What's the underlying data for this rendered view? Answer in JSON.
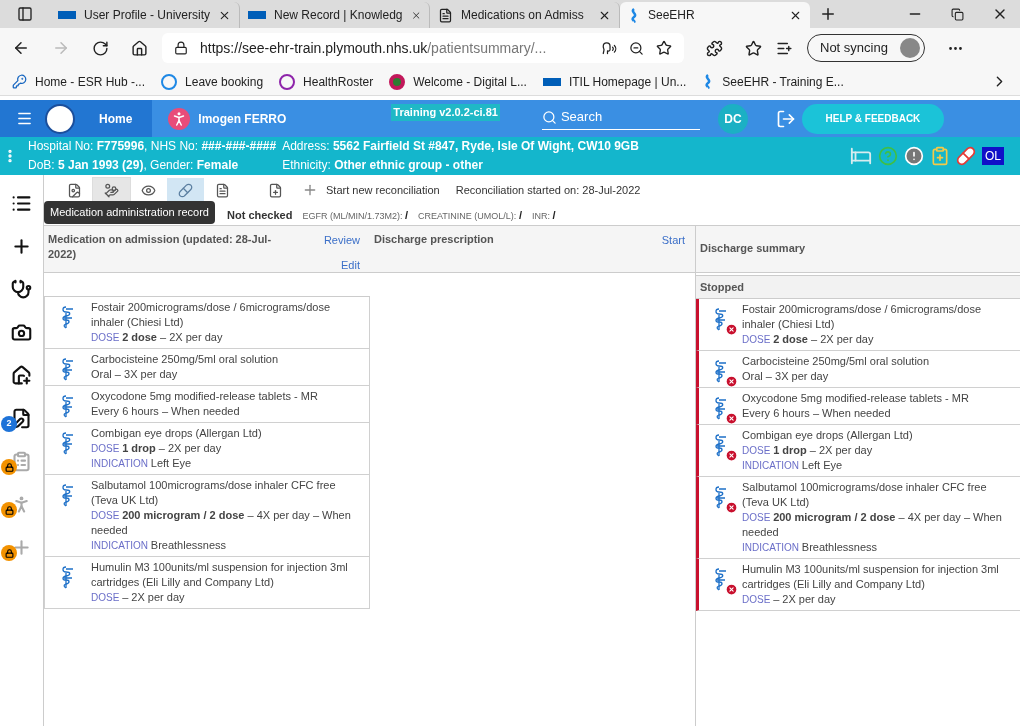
{
  "browser": {
    "tabs": [
      {
        "title": "User Profile - University",
        "selected": false
      },
      {
        "title": "New Record | Knowledg",
        "selected": false
      },
      {
        "title": "Medications on Admiss",
        "selected": false
      },
      {
        "title": "SeeEHR",
        "selected": true
      }
    ],
    "address": {
      "host": "https://see-ehr-train.plymouth.nhs.uk",
      "path": "/patientsummary/..."
    },
    "profile": "Not syncing",
    "bookmarks": [
      "Home - ESR Hub -...",
      "Leave booking",
      "HealthRoster",
      "Welcome - Digital L...",
      "ITIL Homepage | Un...",
      "SeeEHR - Training E..."
    ]
  },
  "header": {
    "home": "Home",
    "patient": "Imogen FERRO",
    "version": "Training v2.0.2-ci.81",
    "search": {
      "placeholder": "Search"
    },
    "user": "DC",
    "help": "HELP & FEEDBACK"
  },
  "banner": {
    "lines": [
      [
        "Hospital No: **F775996**, NHS No: **###-###-####**",
        "Address: **5562 Fairfield St #847, Ryde, Isle Of Wight, CW10 9GB**"
      ],
      [
        "DoB: **5 Jan 1993 (29)**, Gender: **Female**",
        "Ethnicity: **Other ethnic group - other**"
      ]
    ],
    "badge": "OL"
  },
  "sidebar": [
    {
      "kind": "plain"
    },
    {
      "kind": "plain"
    },
    {
      "kind": "plain"
    },
    {
      "kind": "plain"
    },
    {
      "kind": "plain"
    },
    {
      "kind": "count",
      "count": "2"
    },
    {
      "kind": "locked"
    },
    {
      "kind": "locked"
    },
    {
      "kind": "locked"
    }
  ],
  "toolbar": {
    "tools": [
      {
        "selected": false,
        "hovered": false
      },
      {
        "selected": false,
        "hovered": true
      },
      {
        "selected": false,
        "hovered": false
      },
      {
        "selected": true,
        "hovered": false
      },
      {
        "selected": false,
        "hovered": false
      },
      {
        "selected": false,
        "hovered": false
      }
    ],
    "new_reconciliation": "Start new reconciliation",
    "started": "Reconciliation started on: 28-Jul-2022",
    "tooltip": "Medication administration record"
  },
  "info": {
    "allergies": "Not checked",
    "fields": [
      {
        "label": "EGFR (ML/MIN/1.73M2):",
        "value": "/"
      },
      {
        "label": "CREATININE (UMOL/L):",
        "value": "/"
      },
      {
        "label": "INR:",
        "value": "/"
      }
    ]
  },
  "columns": [
    {
      "title": "Medication on admission (updated: 28-Jul-2022)",
      "links": [
        "Review",
        "Edit"
      ]
    },
    {
      "title": "Discharge prescription",
      "links": [
        "Start"
      ]
    },
    {
      "title": "Discharge summary",
      "section": "Stopped"
    }
  ],
  "admission": [
    {
      "name": "Fostair 200micrograms/dose / 6micrograms/dose inhaler (Chiesi Ltd)",
      "lines": [
        {
          "label": "DOSE",
          "text": "**2 dose** – 2X per day"
        }
      ]
    },
    {
      "name": "Carbocisteine 250mg/5ml oral solution",
      "lines": [
        {
          "text": "Oral – 3X per day"
        }
      ]
    },
    {
      "name": "Oxycodone 5mg modified-release tablets - MR",
      "lines": [
        {
          "text": "Every 6 hours – When needed"
        }
      ]
    },
    {
      "name": "Combigan eye drops (Allergan Ltd)",
      "lines": [
        {
          "label": "DOSE",
          "text": "**1 drop** – 2X per day"
        },
        {
          "label": "INDICATION",
          "text": "Left Eye"
        }
      ]
    },
    {
      "name": "Salbutamol 100micrograms/dose inhaler CFC free (Teva UK Ltd)",
      "lines": [
        {
          "label": "DOSE",
          "text": "**200 microgram / 2 dose** – 4X per day – When needed"
        },
        {
          "label": "INDICATION",
          "text": "Breathlessness"
        }
      ]
    },
    {
      "name": "Humulin M3 100units/ml suspension for injection 3ml cartridges (Eli Lilly and Company Ltd)",
      "lines": [
        {
          "label": "DOSE",
          "text": "– 2X per day"
        }
      ]
    }
  ],
  "summary": [
    {
      "name": "Fostair 200micrograms/dose / 6micrograms/dose inhaler (Chiesi Ltd)",
      "stopped": true,
      "lines": [
        {
          "label": "DOSE",
          "text": "**2 dose** – 2X per day"
        }
      ]
    },
    {
      "name": "Carbocisteine 250mg/5ml oral solution",
      "stopped": true,
      "lines": [
        {
          "text": "Oral – 3X per day"
        }
      ]
    },
    {
      "name": "Oxycodone 5mg modified-release tablets - MR",
      "stopped": true,
      "lines": [
        {
          "text": "Every 6 hours – When needed"
        }
      ]
    },
    {
      "name": "Combigan eye drops (Allergan Ltd)",
      "stopped": true,
      "lines": [
        {
          "label": "DOSE",
          "text": "**1 drop** – 2X per day"
        },
        {
          "label": "INDICATION",
          "text": "Left Eye"
        }
      ]
    },
    {
      "name": "Salbutamol 100micrograms/dose inhaler CFC free (Teva UK Ltd)",
      "stopped": true,
      "lines": [
        {
          "label": "DOSE",
          "text": "**200 microgram / 2 dose** – 4X per day – When needed"
        },
        {
          "label": "INDICATION",
          "text": "Breathlessness"
        }
      ]
    },
    {
      "name": "Humulin M3 100units/ml suspension for injection 3ml cartridges (Eli Lilly and Company Ltd)",
      "stopped": true,
      "lines": [
        {
          "label": "DOSE",
          "text": "– 2X per day"
        }
      ]
    }
  ]
}
